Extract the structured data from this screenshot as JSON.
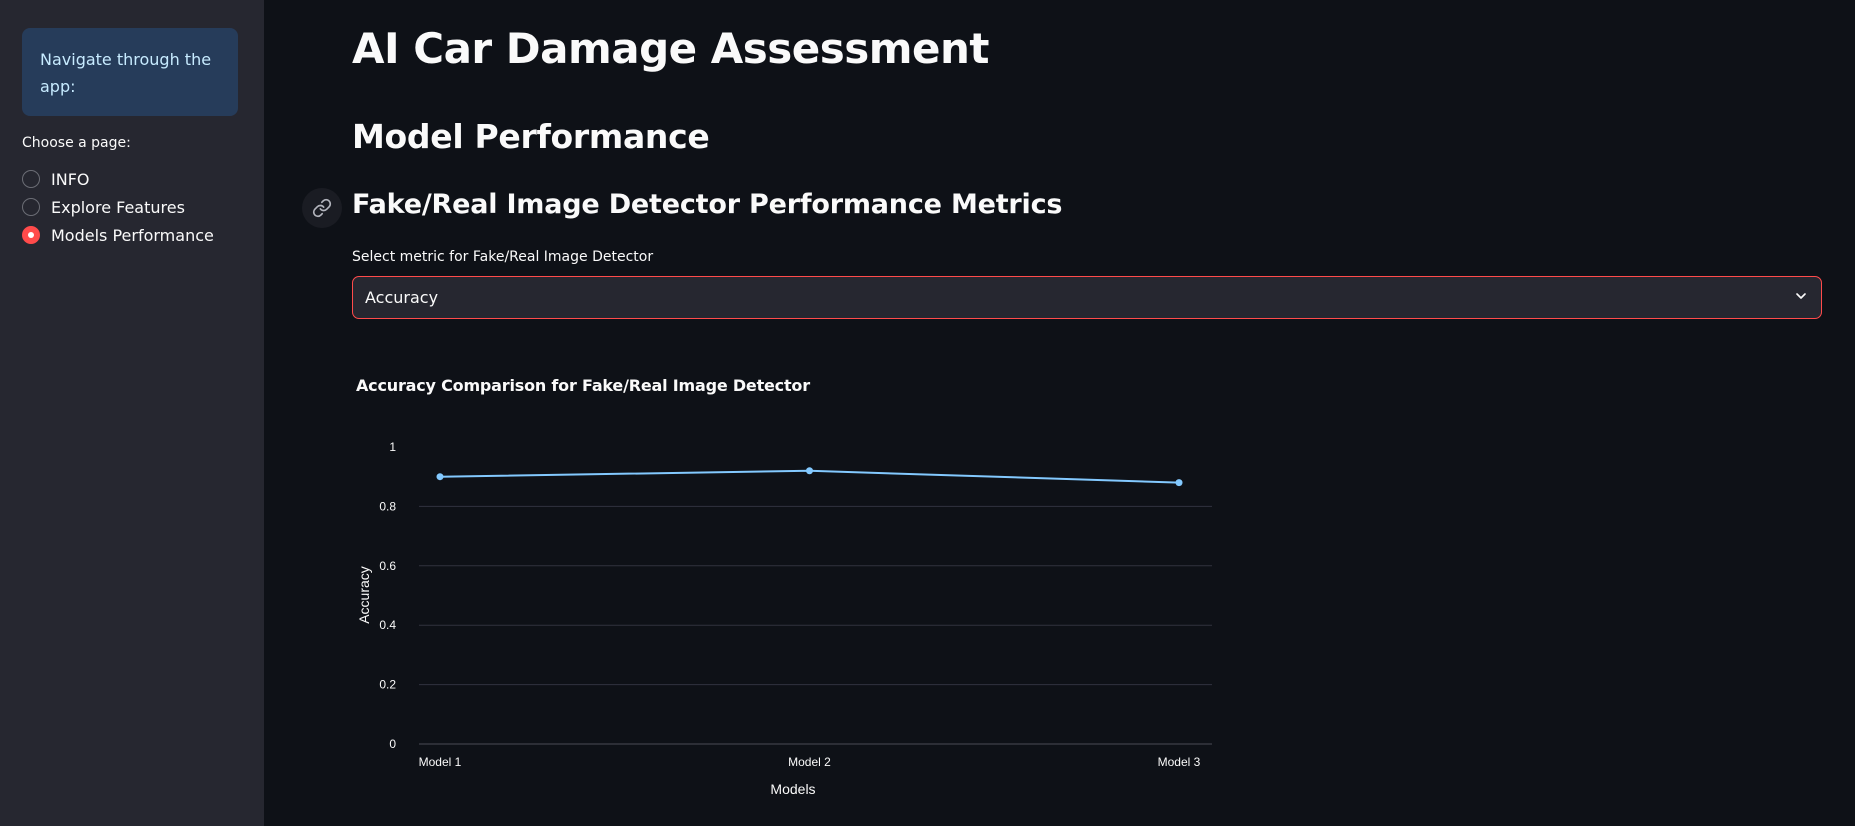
{
  "sidebar": {
    "info_text": "Navigate through the app:",
    "radio_label": "Choose a page:",
    "items": [
      {
        "label": "INFO",
        "selected": false
      },
      {
        "label": "Explore Features",
        "selected": false
      },
      {
        "label": "Models Performance",
        "selected": true
      }
    ]
  },
  "main": {
    "title": "AI Car Damage Assessment",
    "section_title": "Model Performance",
    "subsection_title": "Fake/Real Image Detector Performance Metrics",
    "select": {
      "label": "Select metric for Fake/Real Image Detector",
      "value": "Accuracy"
    }
  },
  "colors": {
    "accent": "#ff4b4b",
    "line": "#83c9ff",
    "grid": "#31333f"
  },
  "icons": {
    "link": "link-icon",
    "dropdown": "chevron-down-icon"
  },
  "chart_data": {
    "type": "line",
    "title": "Accuracy Comparison for Fake/Real Image Detector",
    "xlabel": "Models",
    "ylabel": "Accuracy",
    "categories": [
      "Model 1",
      "Model 2",
      "Model 3"
    ],
    "values": [
      0.9,
      0.92,
      0.88
    ],
    "ylim": [
      0,
      1
    ],
    "yticks": [
      0,
      0.2,
      0.4,
      0.6,
      0.8,
      1
    ],
    "ytick_labels": [
      "0",
      "0.2",
      "0.4",
      "0.6",
      "0.8",
      "1"
    ],
    "grid": true
  }
}
